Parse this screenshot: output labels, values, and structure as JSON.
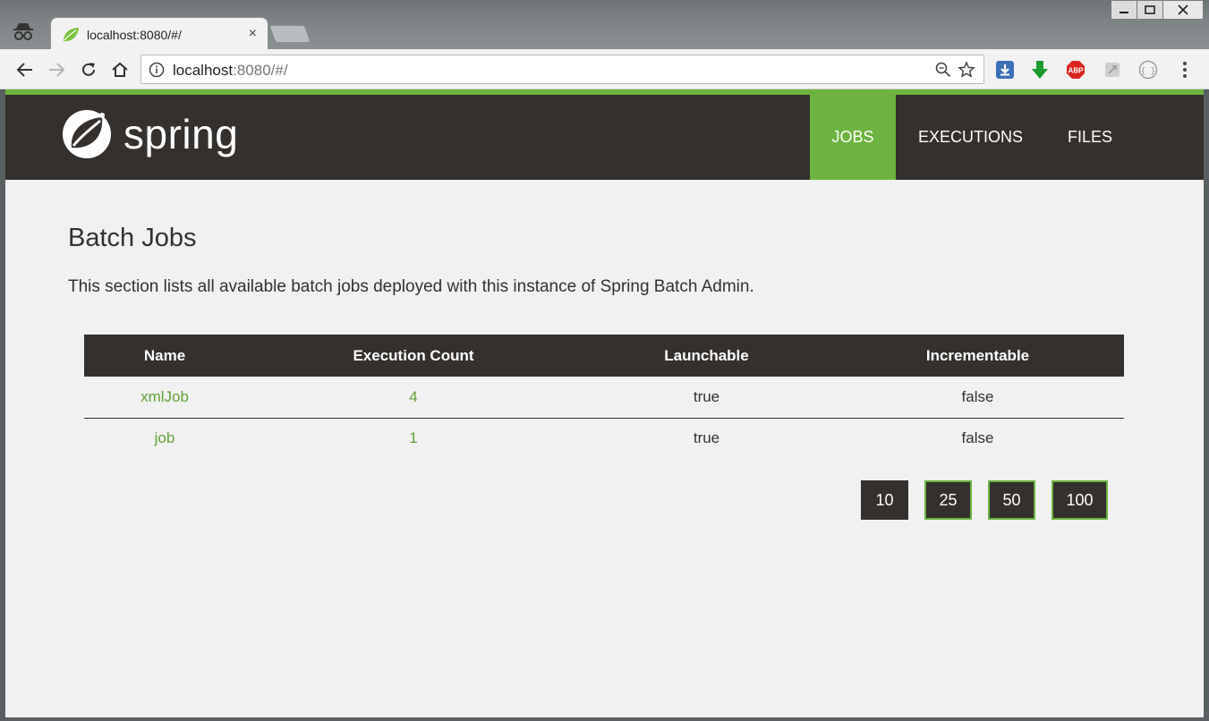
{
  "browser": {
    "tab_title": "localhost:8080/#/",
    "tab_close": "×",
    "url_host": "localhost",
    "url_rest": ":8080/#/",
    "extensions": [
      "download-icon",
      "green-arrow-icon",
      "adblock-icon",
      "extension-icon",
      "json-viewer-icon"
    ],
    "abp_label": "ABP"
  },
  "header": {
    "logo_text": "spring",
    "nav": [
      {
        "label": "JOBS",
        "active": true
      },
      {
        "label": "EXECUTIONS",
        "active": false
      },
      {
        "label": "FILES",
        "active": false
      }
    ]
  },
  "main": {
    "title": "Batch Jobs",
    "description": "This section lists all available batch jobs deployed with this instance of Spring Batch Admin.",
    "table": {
      "headers": [
        "Name",
        "Execution Count",
        "Launchable",
        "Incrementable"
      ],
      "rows": [
        {
          "name": "xmlJob",
          "count": "4",
          "launchable": "true",
          "incrementable": "false"
        },
        {
          "name": "job",
          "count": "1",
          "launchable": "true",
          "incrementable": "false"
        }
      ]
    },
    "page_sizes": [
      "10",
      "25",
      "50",
      "100"
    ],
    "selected_page_size": "10"
  },
  "colors": {
    "accent": "#6db33f",
    "header_bg": "#34302d",
    "page_bg": "#f1f1f1"
  }
}
